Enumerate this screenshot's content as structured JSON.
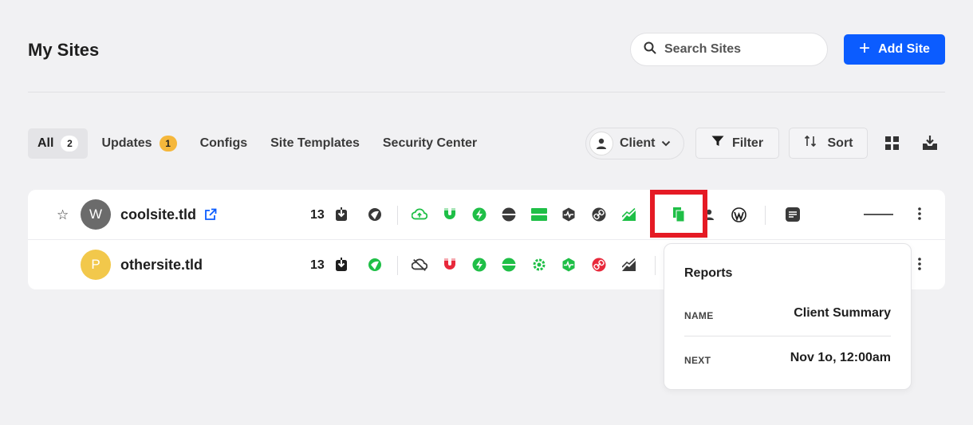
{
  "header": {
    "title": "My Sites",
    "search_placeholder": "Search Sites",
    "add_site_label": "Add Site"
  },
  "tabs": [
    {
      "label": "All",
      "count": "2"
    },
    {
      "label": "Updates",
      "count": "1"
    },
    {
      "label": "Configs"
    },
    {
      "label": "Site Templates"
    },
    {
      "label": "Security Center"
    }
  ],
  "toolbar": {
    "client_label": "Client",
    "filter_label": "Filter",
    "sort_label": "Sort"
  },
  "sites": [
    {
      "avatar_letter": "W",
      "avatar_color": "#6b6b6b",
      "name": "coolsite.tld",
      "updates": "13"
    },
    {
      "avatar_letter": "P",
      "avatar_color": "#f2c84b",
      "name": "othersite.tld",
      "updates": "13"
    }
  ],
  "colors": {
    "accent": "#0b5cff",
    "green": "#1fbf47",
    "red": "#e8293b",
    "dark": "#3a3a3a",
    "warn_badge": "#f5b73b"
  },
  "popover": {
    "title": "Reports",
    "name_label": "NAME",
    "name_value": "Client Summary",
    "next_label": "NEXT",
    "next_value": "Nov 1o, 12:00am"
  }
}
